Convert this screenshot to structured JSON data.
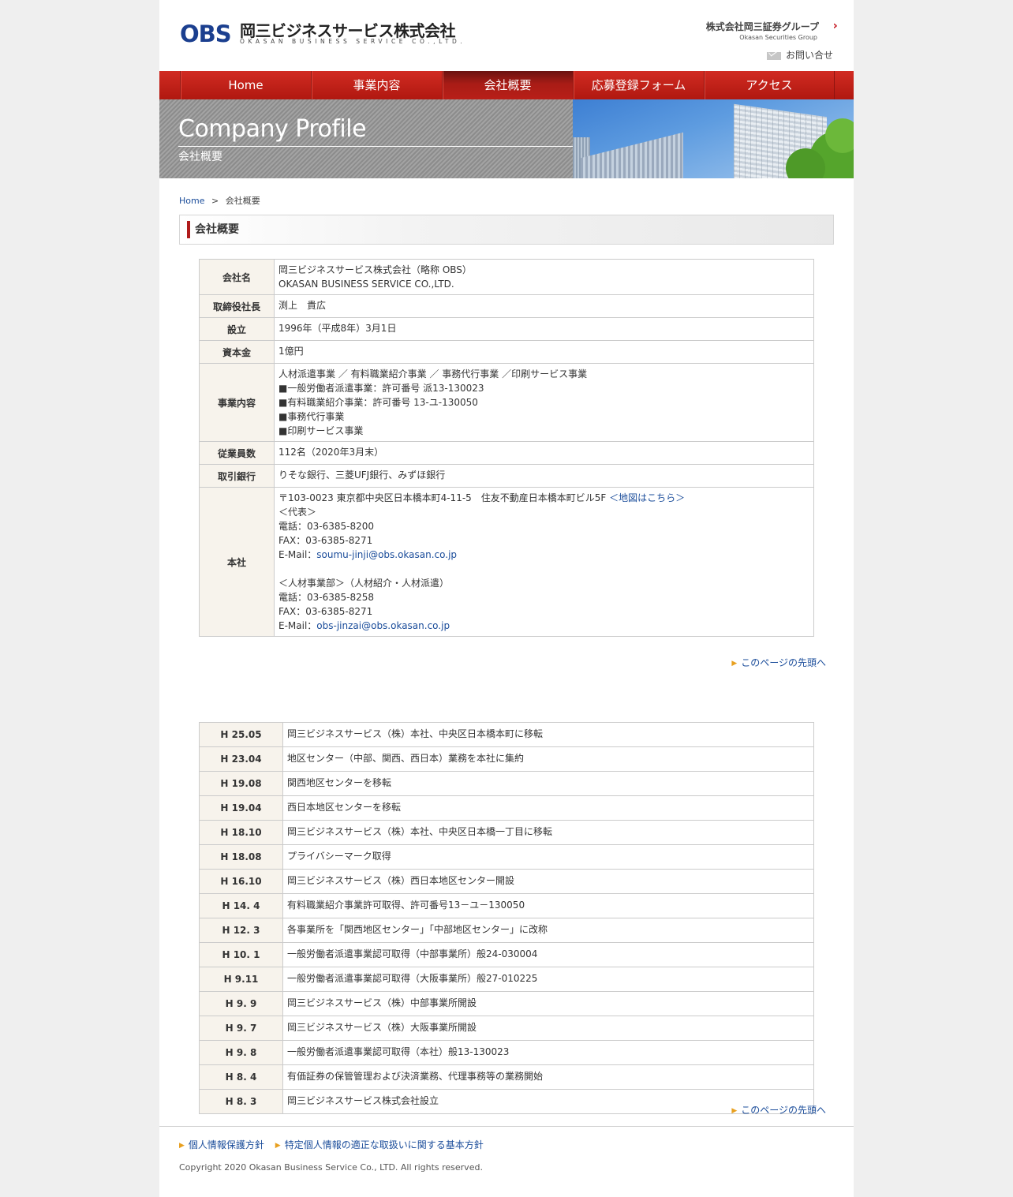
{
  "header": {
    "logo_mark": "OBS",
    "logo_jp": "岡三ビジネスサービス株式会社",
    "logo_en": "OKASAN BUSINESS SERVICE CO.,LTD.",
    "group_jp": "株式会社岡三証券グループ",
    "group_en": "Okasan Securities Group",
    "contact": "お問い合せ"
  },
  "nav": {
    "items": [
      {
        "label": "Home"
      },
      {
        "label": "事業内容"
      },
      {
        "label": "会社概要"
      },
      {
        "label": "応募登録フォーム"
      },
      {
        "label": "アクセス"
      }
    ],
    "active": "会社概要"
  },
  "banner": {
    "title": "Company Profile",
    "subtitle": "会社概要"
  },
  "breadcrumb": {
    "home": "Home",
    "sep": ">",
    "current": "会社概要"
  },
  "section_heading": "会社概要",
  "profile": {
    "company_name": {
      "label": "会社名",
      "line1": "岡三ビジネスサービス株式会社（略称 OBS）",
      "line2": "OKASAN BUSINESS SERVICE CO.,LTD."
    },
    "president": {
      "label": "取締役社長",
      "value": "渕上　貴広"
    },
    "established": {
      "label": "設立",
      "value": "1996年（平成8年）3月1日"
    },
    "capital": {
      "label": "資本金",
      "value": "1億円"
    },
    "business": {
      "label": "事業内容",
      "lines": [
        "人材派遣事業 ／ 有料職業紹介事業 ／ 事務代行事業 ／印刷サービス事業",
        "■一般労働者派遣事業：許可番号 派13-130023",
        "■有料職業紹介事業：許可番号 13-ユ-130050",
        "■事務代行事業",
        "■印刷サービス事業"
      ]
    },
    "employees": {
      "label": "従業員数",
      "value": "112名（2020年3月末）"
    },
    "banks": {
      "label": "取引銀行",
      "value": "りそな銀行、三菱UFJ銀行、みずほ銀行"
    },
    "head_office": {
      "label": "本社",
      "address": "〒103-0023 東京都中央区日本橋本町4-11-5　住友不動産日本橋本町ビル5F",
      "map_link": "＜地図はこちら＞",
      "rep_title": "＜代表＞",
      "rep_tel": "電話：03-6385-8200",
      "rep_fax": "FAX：03-6385-8271",
      "rep_email_label": "E-Mail：",
      "rep_email": "soumu-jinji@obs.okasan.co.jp",
      "hr_title": "＜人材事業部＞（人材紹介・人材派遣）",
      "hr_tel": "電話：03-6385-8258",
      "hr_fax": "FAX：03-6385-8271",
      "hr_email_label": "E-Mail：",
      "hr_email": "obs-jinzai@obs.okasan.co.jp"
    }
  },
  "to_top": "このページの先頭へ",
  "history": [
    {
      "date": "H 25.05",
      "event": "岡三ビジネスサービス（株）本社、中央区日本橋本町に移転"
    },
    {
      "date": "H 23.04",
      "event": "地区センター（中部、関西、西日本）業務を本社に集約"
    },
    {
      "date": "H 19.08",
      "event": "関西地区センターを移転"
    },
    {
      "date": "H 19.04",
      "event": "西日本地区センターを移転"
    },
    {
      "date": "H 18.10",
      "event": "岡三ビジネスサービス（株）本社、中央区日本橋一丁目に移転"
    },
    {
      "date": "H 18.08",
      "event": "プライバシーマーク取得"
    },
    {
      "date": "H 16.10",
      "event": "岡三ビジネスサービス（株）西日本地区センター開設"
    },
    {
      "date": "H 14. 4",
      "event": "有料職業紹介事業許可取得、許可番号13－ユ－130050"
    },
    {
      "date": "H 12. 3",
      "event": "各事業所を「関西地区センター」「中部地区センター」に改称"
    },
    {
      "date": "H 10. 1",
      "event": "一般労働者派遣事業認可取得（中部事業所）般24-030004"
    },
    {
      "date": "H 9.11",
      "event": "一般労働者派遣事業認可取得（大阪事業所）般27-010225"
    },
    {
      "date": "H 9. 9",
      "event": "岡三ビジネスサービス（株）中部事業所開設"
    },
    {
      "date": "H 9. 7",
      "event": "岡三ビジネスサービス（株）大阪事業所開設"
    },
    {
      "date": "H 9. 8",
      "event": "一般労働者派遣事業認可取得（本社）般13-130023"
    },
    {
      "date": "H 8. 4",
      "event": "有価証券の保管管理および決済業務、代理事務等の業務開始"
    },
    {
      "date": "H 8. 3",
      "event": "岡三ビジネスサービス株式会社設立"
    }
  ],
  "footer": {
    "link1": "個人情報保護方針",
    "link2": "特定個人情報の適正な取扱いに関する基本方針",
    "copyright": "Copyright 2020 Okasan Business Service Co., LTD. All rights reserved."
  },
  "colors": {
    "nav_red": "#c21f18",
    "link_blue": "#1a4c9a",
    "th_bg": "#f7f3ec",
    "accent_bar": "#b01b1b"
  }
}
